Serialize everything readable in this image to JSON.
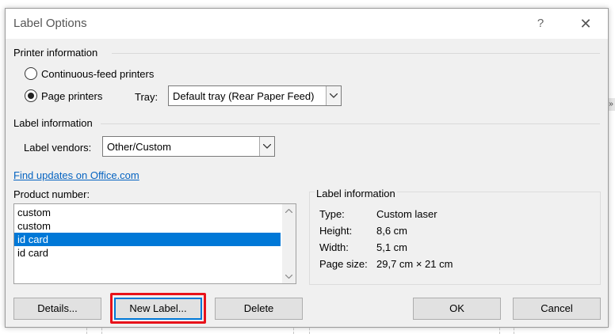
{
  "dialog": {
    "title": "Label Options",
    "help_icon": "?",
    "close_icon": "✕"
  },
  "printer_information": {
    "heading": "Printer information",
    "continuous_label": "Continuous-feed printers",
    "page_label": "Page printers",
    "selected": "page",
    "tray_label": "Tray:",
    "tray_value": "Default tray (Rear Paper Feed)"
  },
  "label_information_group": {
    "heading": "Label information",
    "vendors_label": "Label vendors:",
    "vendors_value": "Other/Custom"
  },
  "find_updates_link": "Find updates on Office.com",
  "product_number": {
    "label": "Product number:",
    "items": [
      "custom",
      "custom",
      "id card",
      "id card"
    ],
    "selected_index": 2
  },
  "label_info_panel": {
    "heading": "Label information",
    "rows": [
      {
        "key": "Type:",
        "value": "Custom laser"
      },
      {
        "key": "Height:",
        "value": "8,6 cm"
      },
      {
        "key": "Width:",
        "value": "5,1 cm"
      },
      {
        "key": "Page size:",
        "value": "29,7 cm × 21 cm"
      }
    ]
  },
  "buttons": {
    "details": "Details...",
    "new_label": "New Label...",
    "delete": "Delete",
    "ok": "OK",
    "cancel": "Cancel"
  },
  "colors": {
    "accent": "#0078d7",
    "link": "#0563c1",
    "highlight": "#e8121a"
  },
  "background": {
    "ribbon_arrow": "»"
  }
}
